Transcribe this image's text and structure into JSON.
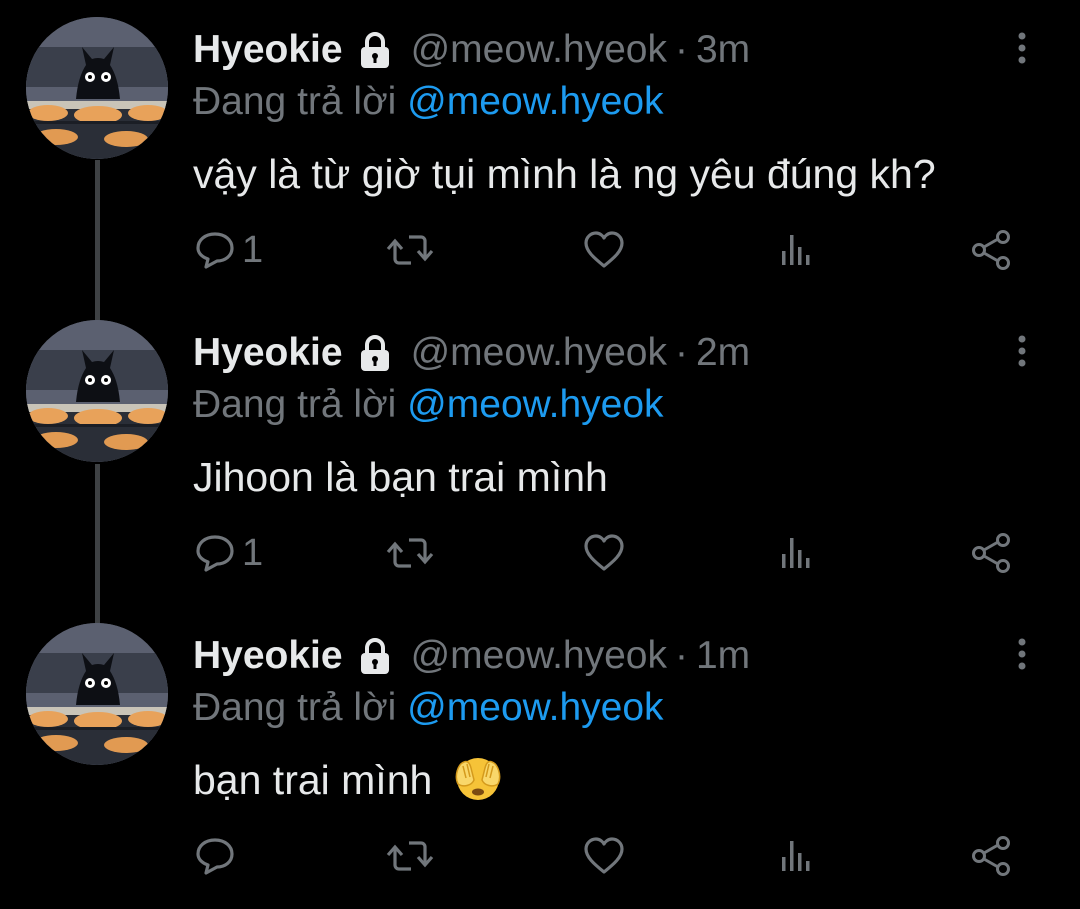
{
  "colors": {
    "background": "#000000",
    "text_primary": "#e7e9ea",
    "text_secondary": "#71767b",
    "accent": "#1d9bf0",
    "thread_line": "#3e4144"
  },
  "tweets": [
    {
      "display_name": "Hyeokie",
      "protected_icon": "lock-icon",
      "handle": "@meow.hyeok",
      "separator": "·",
      "time": "3m",
      "reply_prefix": "Đang trả lời",
      "reply_to": "@meow.hyeok",
      "text": "vậy là từ giờ tụi mình là ng yêu đúng kh?",
      "emoji": "",
      "reply_count": "1"
    },
    {
      "display_name": "Hyeokie",
      "protected_icon": "lock-icon",
      "handle": "@meow.hyeok",
      "separator": "·",
      "time": "2m",
      "reply_prefix": "Đang trả lời",
      "reply_to": "@meow.hyeok",
      "text": "Jihoon là bạn trai mình",
      "emoji": "",
      "reply_count": "1"
    },
    {
      "display_name": "Hyeokie",
      "protected_icon": "lock-icon",
      "handle": "@meow.hyeok",
      "separator": "·",
      "time": "1m",
      "reply_prefix": "Đang trả lời",
      "reply_to": "@meow.hyeok",
      "text": "bạn trai mình",
      "emoji": "see-no-evil-face-emoji",
      "reply_count": ""
    }
  ],
  "action_icons": [
    "reply-icon",
    "retweet-icon",
    "like-icon",
    "views-icon",
    "share-icon"
  ]
}
